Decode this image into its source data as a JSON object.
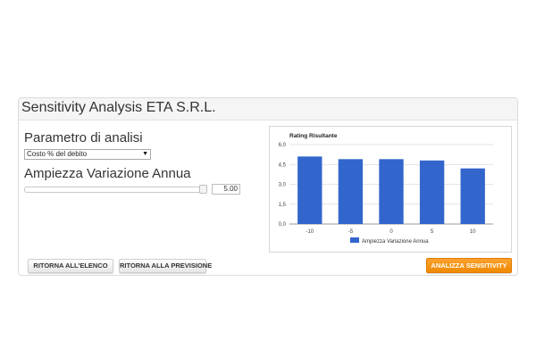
{
  "panel": {
    "title": "Sensitivity Analysis ETA S.R.L."
  },
  "form": {
    "parameter_label": "Parametro di analisi",
    "parameter_selected": "Costo % del debito",
    "range_label": "Ampiezza Variazione Annua",
    "range_value_text": "5.00",
    "range_level_fraction": 1.0
  },
  "buttons": {
    "back_to_list": "RITORNA ALL'ELENCO",
    "back_to_forecast": "RITORNA ALLA PREVISIONE",
    "analyze": "ANALIZZA SENSITIVITY"
  },
  "colors": {
    "bar": "#3366cc",
    "analyze_button": "#f08a00",
    "gridline": "#cccccc"
  },
  "chart_data": {
    "type": "bar",
    "title": "Rating Risultante",
    "categories": [
      "-10",
      "-5",
      "0",
      "5",
      "10"
    ],
    "series": [
      {
        "name": "Ampiezza Variazione Annua",
        "values": [
          5.1,
          4.9,
          4.9,
          4.8,
          4.2
        ]
      }
    ],
    "ylim": [
      0,
      6
    ],
    "yticks": [
      0,
      1.5,
      3,
      4.5,
      6
    ],
    "ytick_labels": [
      "0,0",
      "1,5",
      "3,0",
      "4,5",
      "6,0"
    ],
    "grid": true,
    "legend": "bottom"
  }
}
